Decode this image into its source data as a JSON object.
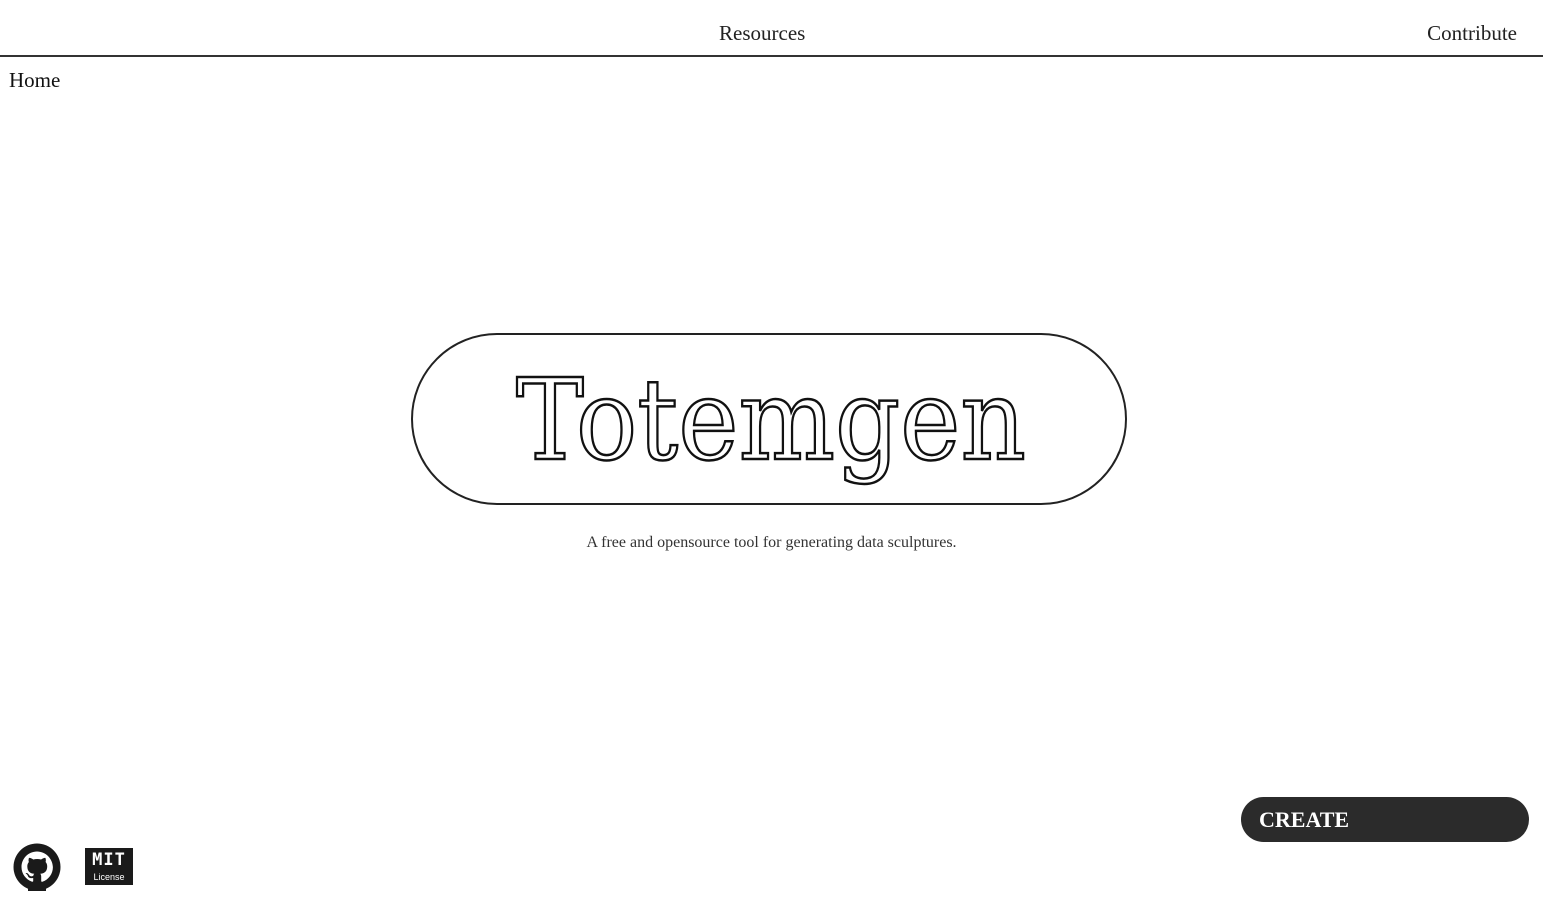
{
  "nav": {
    "resources": "Resources",
    "contribute": "Contribute",
    "home": "Home"
  },
  "hero": {
    "logo_text": "Totemgen",
    "tagline": "A free and opensource tool for generating data sculptures."
  },
  "actions": {
    "create_label": "CREATE"
  },
  "footer": {
    "github_icon": "github-icon",
    "mit_badge_letters": "MIT",
    "mit_badge_label": "License"
  },
  "colors": {
    "background": "#ffffff",
    "text": "#222222",
    "button": "#2b2b2b",
    "button_text": "#ffffff"
  }
}
